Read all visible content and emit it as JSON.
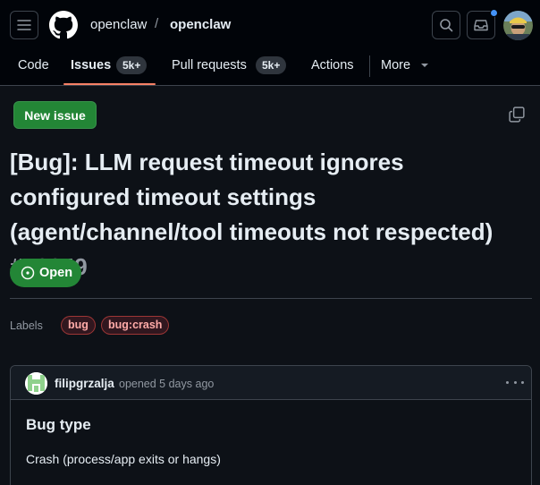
{
  "header": {
    "owner": "openclaw",
    "separator": "/",
    "repo": "openclaw",
    "notification_dot_color": "#4493f8"
  },
  "tabs": [
    {
      "label": "Code"
    },
    {
      "label": "Issues",
      "counter": "5k+",
      "selected": true
    },
    {
      "label": "Pull requests",
      "counter": "5k+"
    },
    {
      "label": "Actions"
    },
    {
      "label": "More"
    }
  ],
  "actions": {
    "new_issue_label": "New issue"
  },
  "issue": {
    "title": "[Bug]: LLM request timeout ignores configured timeout settings (agent/channel/tool timeouts not respected)",
    "number": "#46049",
    "state": "Open",
    "state_color": "#238636",
    "labels_title": "Labels",
    "labels": [
      {
        "name": "bug",
        "color": "#d73a4a"
      },
      {
        "name": "bug:crash",
        "color": "#d73a4a"
      }
    ]
  },
  "comment": {
    "author": "filipgrzalja",
    "meta": "opened 5 days ago",
    "heading": "Bug type",
    "body": "Crash (process/app exits or hangs)"
  },
  "icons": [
    "hamburger-menu-icon",
    "github-mark-icon",
    "search-icon",
    "inbox-icon",
    "copy-icon",
    "issue-opened-icon",
    "kebab-horizontal-icon"
  ]
}
